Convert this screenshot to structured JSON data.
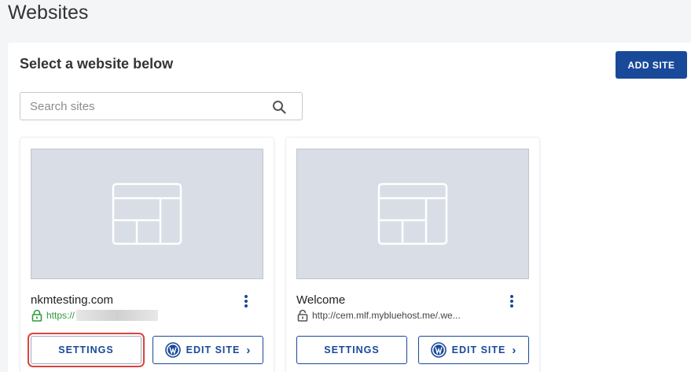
{
  "page": {
    "title": "Websites"
  },
  "panel": {
    "heading": "Select a website below",
    "add_site_label": "ADD SITE"
  },
  "search": {
    "placeholder": "Search sites",
    "value": ""
  },
  "sites": [
    {
      "name": "nkmtesting.com",
      "url": "https://",
      "secure": true,
      "settings_label": "SETTINGS",
      "edit_label": "EDIT SITE",
      "settings_highlighted": true
    },
    {
      "name": "Welcome",
      "url": "http://cem.mlf.mybluehost.me/.we...",
      "secure": false,
      "settings_label": "SETTINGS",
      "edit_label": "EDIT SITE",
      "settings_highlighted": false
    }
  ],
  "colors": {
    "primary": "#194999",
    "secure_green": "#2e9a3c",
    "thumbnail_bg": "#d8dde6",
    "highlight_red": "#d9453c"
  }
}
